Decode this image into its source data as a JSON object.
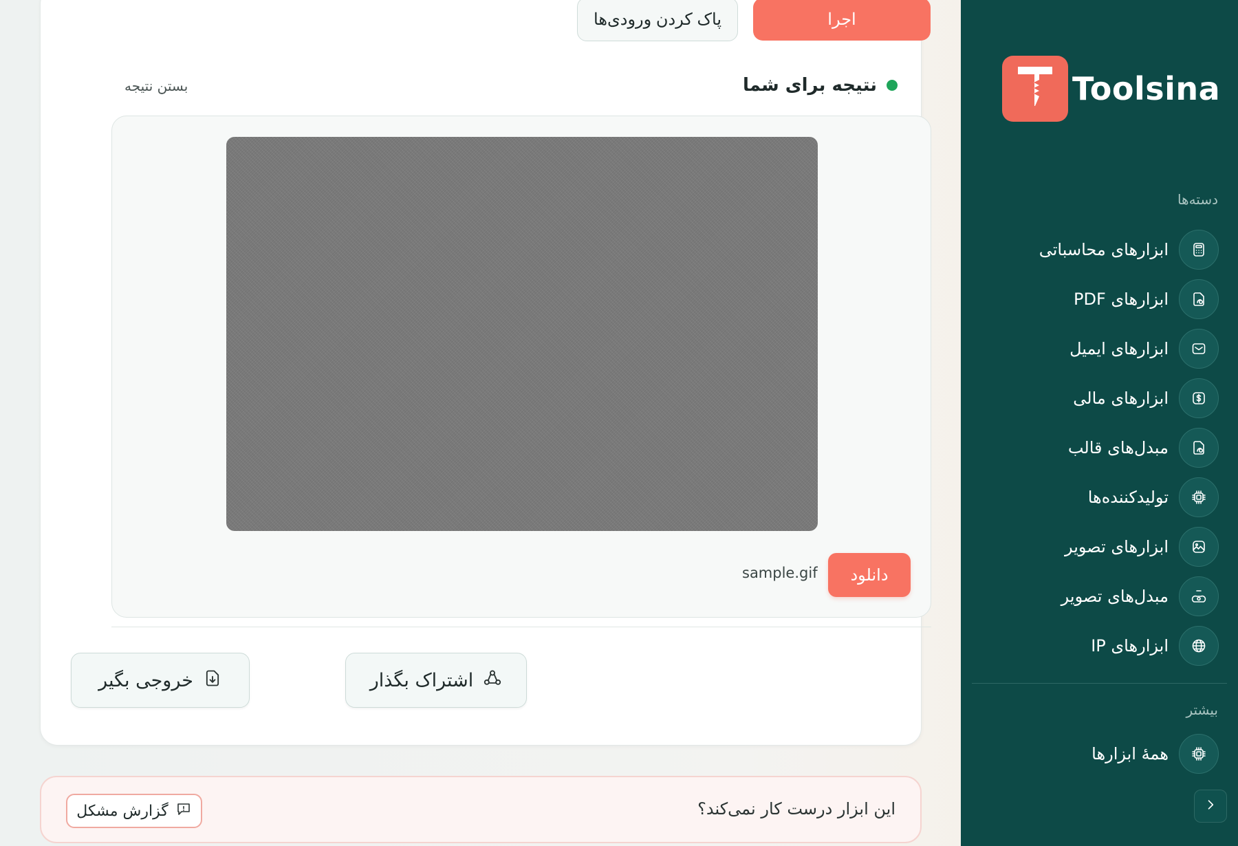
{
  "toolbar": {
    "run_label": "اجرا",
    "clear_label": "پاک کردن ورودی‌ها"
  },
  "result": {
    "title": "نتیجه برای شما",
    "close_label": "بستن نتیجه",
    "download_label": "دانلود",
    "file_name": "sample.gif"
  },
  "actions": {
    "export_label": "خروجی بگیر",
    "share_label": "اشتراک بگذار"
  },
  "report": {
    "question": "این ابزار درست کار نمی‌کند؟",
    "button_label": "گزارش مشکل"
  },
  "sidebar": {
    "brand": "Toolsina",
    "categories_heading": "دسته‌ها",
    "items": [
      {
        "label": "ابزارهای محاسباتی",
        "icon": "calculator-icon"
      },
      {
        "label": "ابزارهای PDF",
        "icon": "document-icon"
      },
      {
        "label": "ابزارهای ایمیل",
        "icon": "mail-icon"
      },
      {
        "label": "ابزارهای مالی",
        "icon": "dollar-icon"
      },
      {
        "label": "مبدل‌های قالب",
        "icon": "document-icon"
      },
      {
        "label": "تولیدکننده‌ها",
        "icon": "chip-icon"
      },
      {
        "label": "ابزارهای تصویر",
        "icon": "image-icon"
      },
      {
        "label": "مبدل‌های تصویر",
        "icon": "image-convert-icon"
      },
      {
        "label": "ابزارهای IP",
        "icon": "globe-icon"
      }
    ],
    "more_heading": "بیشتر",
    "all_tools_label": "همهٔ ابزارها"
  },
  "colors": {
    "accent": "#f87362",
    "sidebar_bg": "#0d4a47",
    "status_dot": "#1fa55a"
  }
}
